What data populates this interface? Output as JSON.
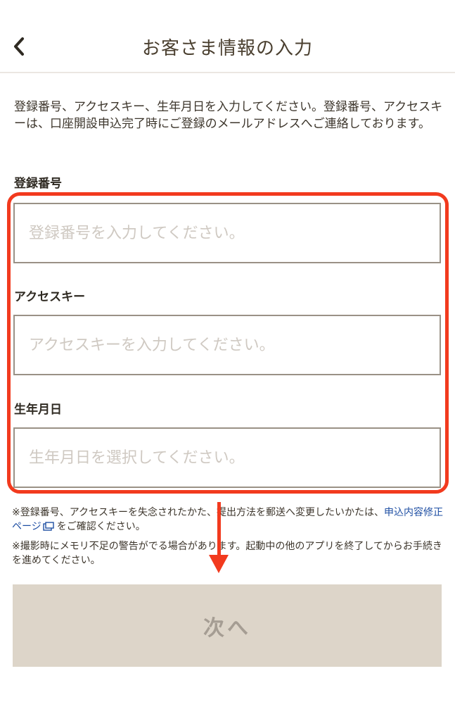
{
  "header": {
    "title": "お客さま情報の入力",
    "back_icon": "chevron-left-icon"
  },
  "intro_text": "登録番号、アクセスキー、生年月日を入力してください。登録番号、アクセスキーは、口座開設申込完了時にご登録のメールアドレスへご連絡しております。",
  "form": {
    "registration_number": {
      "label": "登録番号",
      "value": "",
      "placeholder": "登録番号を入力してください。"
    },
    "access_key": {
      "label": "アクセスキー",
      "value": "",
      "placeholder": "アクセスキーを入力してください。"
    },
    "birth_date": {
      "label": "生年月日",
      "value": "",
      "placeholder": "生年月日を選択してください。"
    }
  },
  "notes": {
    "note1_before": "※登録番号、アクセスキーを失念されたかた、提出方法を郵送へ変更したいかたは、",
    "note1_link": "申込内容修正ページ",
    "note1_after": "をご確認ください。",
    "note2": "※撮影時にメモリ不足の警告がでる場合があります。起動中の他のアプリを終了してからお手続きを進めてください。"
  },
  "next_button": {
    "label": "次へ"
  },
  "colors": {
    "annotation_red": "#f23a1e",
    "link_blue": "#1f4fa3",
    "button_disabled_bg": "#ddd5c9",
    "button_disabled_text": "#a59d93"
  }
}
